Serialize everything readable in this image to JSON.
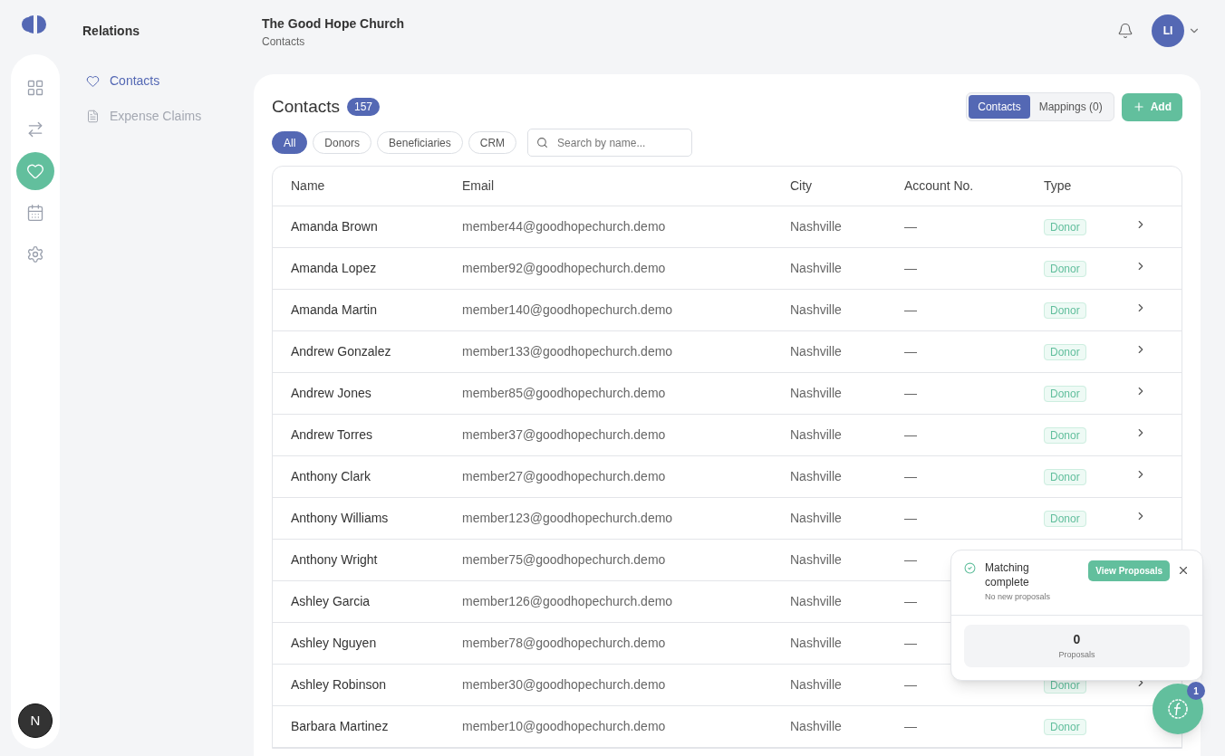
{
  "app": {
    "section_title": "Relations",
    "nav": [
      {
        "label": "Contacts",
        "selected": true
      },
      {
        "label": "Expense Claims",
        "selected": false
      }
    ],
    "rail": [
      {
        "selected": false
      },
      {
        "selected": false
      },
      {
        "selected": true
      },
      {
        "selected": false
      },
      {
        "selected": false
      }
    ],
    "dev_badge": "N"
  },
  "header": {
    "org": "The Good Hope Church",
    "breadcrumb": "Contacts",
    "avatar": "LI"
  },
  "contacts": {
    "title": "Contacts",
    "count": "157",
    "views": [
      {
        "label": "Contacts",
        "selected": true
      },
      {
        "label": "Mappings (0)",
        "selected": false
      }
    ],
    "add_button": "Add",
    "filters": [
      {
        "label": "All",
        "selected": true
      },
      {
        "label": "Donors",
        "selected": false
      },
      {
        "label": "Beneficiaries",
        "selected": false
      },
      {
        "label": "CRM",
        "selected": false
      }
    ],
    "search": {
      "placeholder": "Search by name..."
    },
    "columns": [
      "Name",
      "Email",
      "City",
      "Account No.",
      "Type"
    ],
    "rows": [
      {
        "name": "Amanda Brown",
        "email": "member44@goodhopechurch.demo",
        "city": "Nashville",
        "account": "—",
        "type": "Donor",
        "chevron": true
      },
      {
        "name": "Amanda Lopez",
        "email": "member92@goodhopechurch.demo",
        "city": "Nashville",
        "account": "—",
        "type": "Donor",
        "chevron": true
      },
      {
        "name": "Amanda Martin",
        "email": "member140@goodhopechurch.demo",
        "city": "Nashville",
        "account": "—",
        "type": "Donor",
        "chevron": true
      },
      {
        "name": "Andrew Gonzalez",
        "email": "member133@goodhopechurch.demo",
        "city": "Nashville",
        "account": "—",
        "type": "Donor",
        "chevron": true
      },
      {
        "name": "Andrew Jones",
        "email": "member85@goodhopechurch.demo",
        "city": "Nashville",
        "account": "—",
        "type": "Donor",
        "chevron": true
      },
      {
        "name": "Andrew Torres",
        "email": "member37@goodhopechurch.demo",
        "city": "Nashville",
        "account": "—",
        "type": "Donor",
        "chevron": true
      },
      {
        "name": "Anthony Clark",
        "email": "member27@goodhopechurch.demo",
        "city": "Nashville",
        "account": "—",
        "type": "Donor",
        "chevron": true
      },
      {
        "name": "Anthony Williams",
        "email": "member123@goodhopechurch.demo",
        "city": "Nashville",
        "account": "—",
        "type": "Donor",
        "chevron": true
      },
      {
        "name": "Anthony Wright",
        "email": "member75@goodhopechurch.demo",
        "city": "Nashville",
        "account": "—",
        "chevron": false
      },
      {
        "name": "Ashley Garcia",
        "email": "member126@goodhopechurch.demo",
        "city": "Nashville",
        "account": "—",
        "chevron": false
      },
      {
        "name": "Ashley Nguyen",
        "email": "member78@goodhopechurch.demo",
        "city": "Nashville",
        "account": "—",
        "chevron": false
      },
      {
        "name": "Ashley Robinson",
        "email": "member30@goodhopechurch.demo",
        "city": "Nashville",
        "account": "—",
        "type": "Donor",
        "chevron": true
      },
      {
        "name": "Barbara Martinez",
        "email": "member10@goodhopechurch.demo",
        "city": "Nashville",
        "account": "—",
        "type": "Donor",
        "chevron": false
      }
    ]
  },
  "toast": {
    "title": "Matching complete",
    "subtitle": "No new proposals",
    "action": "View Proposals",
    "stat_value": "0",
    "stat_label": "Proposals"
  },
  "assistant": {
    "badge": "1"
  }
}
